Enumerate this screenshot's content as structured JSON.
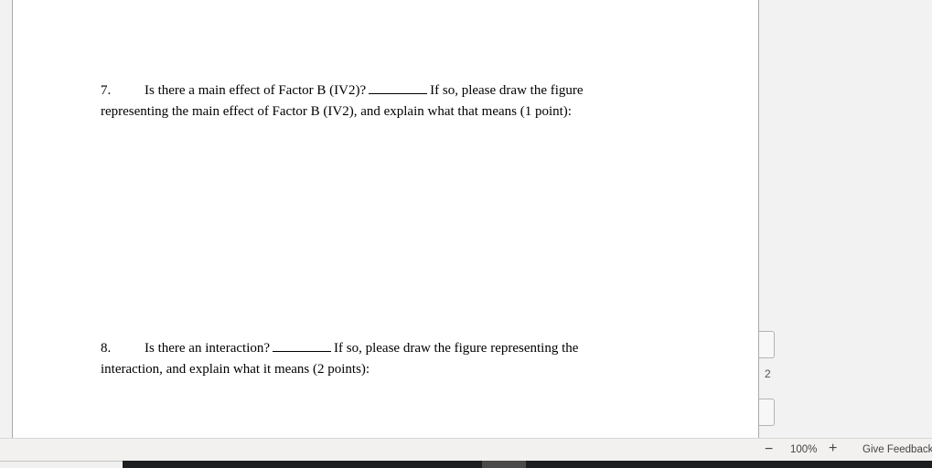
{
  "document": {
    "questions": [
      {
        "number": "7.",
        "line1_before": "Is there a main effect of Factor B (IV2)?",
        "line1_after": "If so, please draw the figure",
        "line2": "representing the main effect of Factor B (IV2), and explain what that means (1 point):"
      },
      {
        "number": "8.",
        "line1_before": "Is there an interaction?",
        "line1_after": "If so, please draw the figure representing the",
        "line2": "interaction, and explain what it means (2 points):"
      }
    ]
  },
  "page_indicator": {
    "current_page": "2"
  },
  "statusbar": {
    "zoom_out_label": "−",
    "zoom_level": "100%",
    "zoom_in_label": "+",
    "feedback_label": "Give Feedback"
  }
}
